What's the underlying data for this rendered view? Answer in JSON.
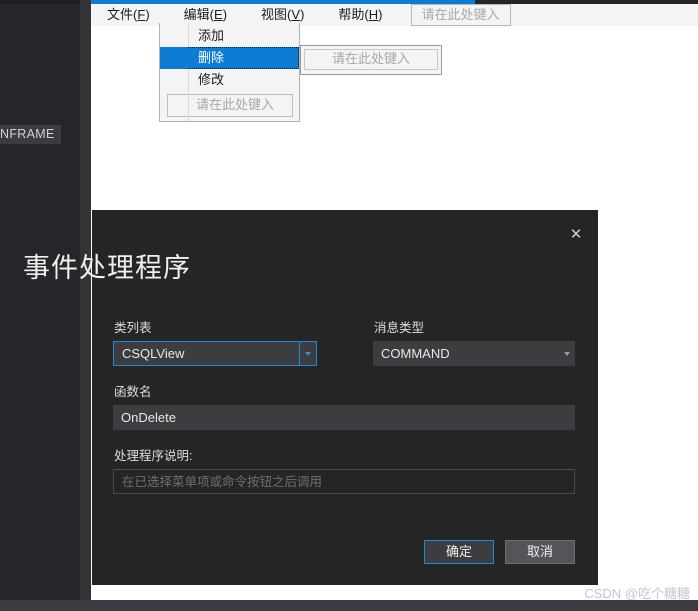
{
  "workspace": {
    "left_panel_chip": "NFRAME"
  },
  "menubar": {
    "items": [
      {
        "label": "文件",
        "mnemonic": "F"
      },
      {
        "label": "编辑",
        "mnemonic": "E"
      },
      {
        "label": "视图",
        "mnemonic": "V"
      },
      {
        "label": "帮助",
        "mnemonic": "H"
      }
    ],
    "type_here_placeholder": "请在此处键入"
  },
  "edit_menu": {
    "items": [
      {
        "label": "添加",
        "selected": false
      },
      {
        "label": "删除",
        "selected": true
      },
      {
        "label": "修改",
        "selected": false
      }
    ],
    "type_here_placeholder": "请在此处键入",
    "submenu_placeholder": "请在此处键入"
  },
  "dialog": {
    "title": "事件处理程序",
    "close_icon": "✕",
    "fields": {
      "class_list": {
        "label": "类列表",
        "value": "CSQLView"
      },
      "message_type": {
        "label": "消息类型",
        "value": "COMMAND"
      },
      "function_name": {
        "label": "函数名",
        "value": "OnDelete"
      },
      "handler_description": {
        "label": "处理程序说明:",
        "value": "在已选择菜单项或命令按钮之后调用"
      }
    },
    "buttons": {
      "ok": "确定",
      "cancel": "取消"
    }
  },
  "watermark": {
    "text": "CSDN @吃个糖糖"
  },
  "colors": {
    "accent_blue": "#0c7cd5",
    "focus_blue": "#1e8ad6",
    "dialog_bg": "#252526",
    "field_bg": "#3c3c41"
  }
}
